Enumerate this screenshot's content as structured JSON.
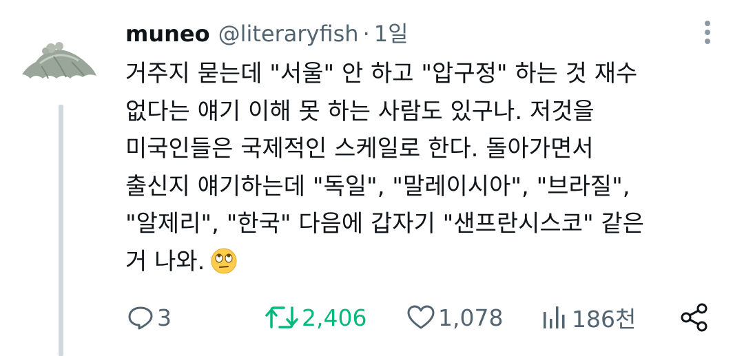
{
  "tweet": {
    "author": {
      "name": "muneo",
      "handle": "@literaryfish",
      "separator": "·",
      "time": "1일"
    },
    "text_lines": [
      "거주지 묻는데 \"서울\" 안 하고 \"압구정\" 하는 것 재수",
      "없다는 얘기 이해 못 하는 사람도 있구나. 저것을",
      "미국인들은 국제적인 스케일로 한다. 돌아가면서",
      "출신지 얘기하는데 \"독일\", \"말레이시아\", \"브라질\",",
      "\"알제리\", \"한국\" 다음에 갑자기 \"샌프란시스코\" 같은",
      "거 나와."
    ],
    "emoji": "face-with-rolling-eyes",
    "stats": {
      "replies": "3",
      "retweets": "2,406",
      "likes": "1,078",
      "views": "186천"
    },
    "colors": {
      "text": "#0f1419",
      "secondary": "#536471",
      "retweet_active": "#00ba7c",
      "thread_line": "#cfd9de"
    }
  }
}
